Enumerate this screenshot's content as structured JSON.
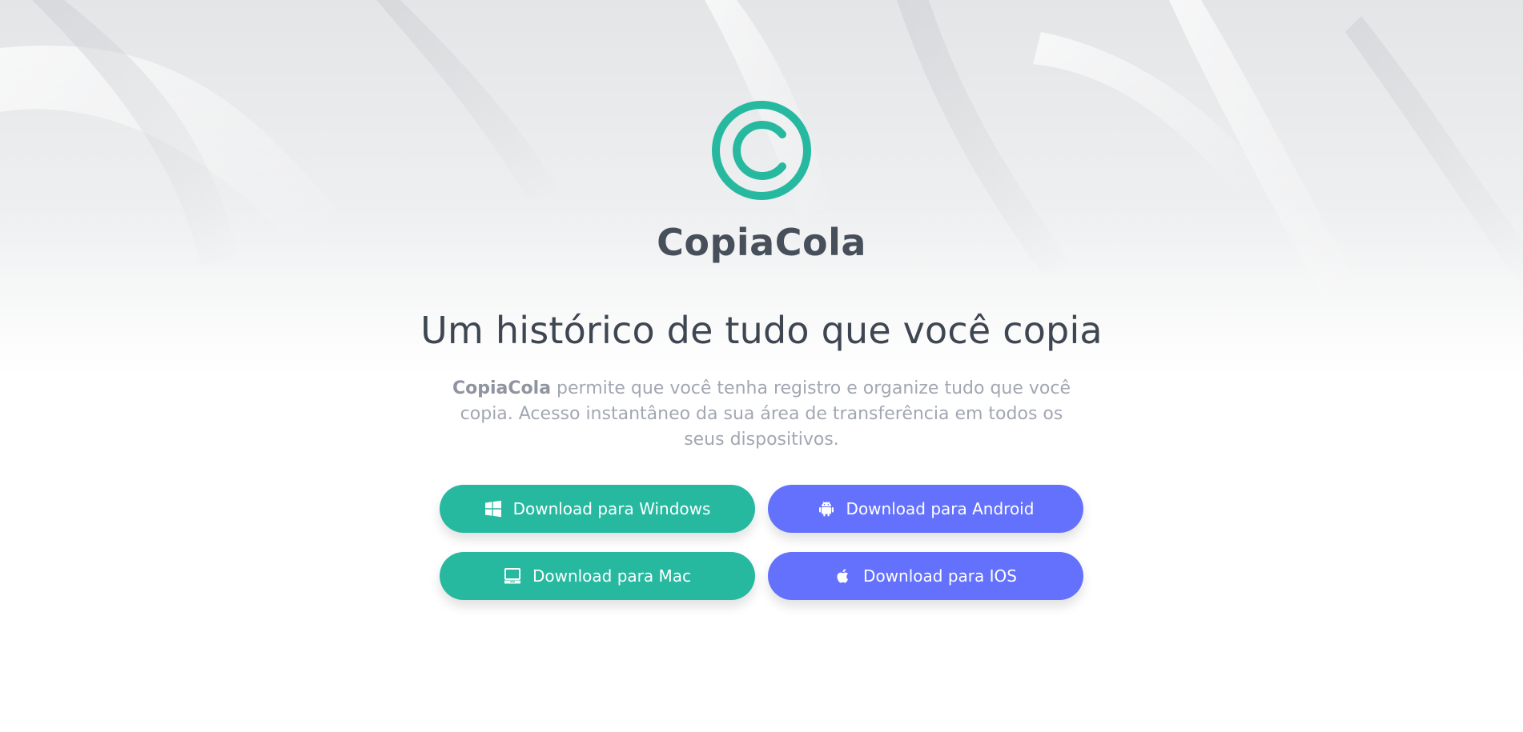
{
  "brand": {
    "name": "CopiaCola",
    "logo_icon": "copyright-icon",
    "accent_color": "#26b9a0"
  },
  "hero": {
    "headline": "Um histórico de tudo que você copia",
    "description_brand": "CopiaCola",
    "description_text": " permite que você tenha registro e organize tudo que você copia. Acesso instantâneo da sua área de transferência em todos os seus dispositivos."
  },
  "downloads": {
    "windows": {
      "label": "Download para Windows",
      "icon": "windows-icon",
      "color": "#26b9a0"
    },
    "android": {
      "label": "Download para Android",
      "icon": "android-icon",
      "color": "#6471fc"
    },
    "mac": {
      "label": "Download para Mac",
      "icon": "laptop-icon",
      "color": "#26b9a0"
    },
    "ios": {
      "label": "Download para IOS",
      "icon": "apple-icon",
      "color": "#6471fc"
    }
  }
}
